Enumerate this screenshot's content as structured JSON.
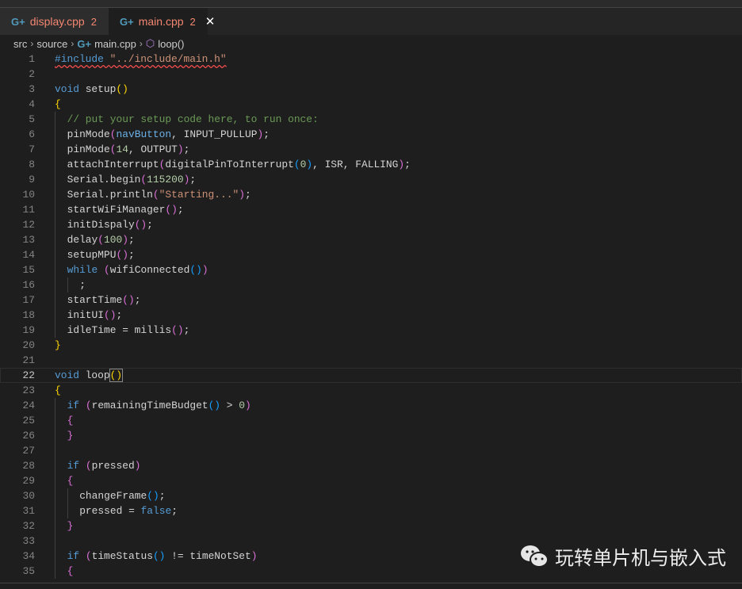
{
  "tabs": [
    {
      "label": "display.cpp",
      "problems": "2",
      "active": false
    },
    {
      "label": "main.cpp",
      "problems": "2",
      "active": true
    }
  ],
  "breadcrumb": [
    "src",
    "source",
    "main.cpp",
    "loop()"
  ],
  "current_line": 22,
  "lines": [
    {
      "n": "1",
      "i": 0,
      "t": [
        [
          "#include ",
          "inc"
        ],
        [
          "\"../include/main.h\"",
          "incs"
        ]
      ]
    },
    {
      "n": "2",
      "i": 0,
      "t": []
    },
    {
      "n": "3",
      "i": 0,
      "t": [
        [
          "void",
          "kw"
        ],
        [
          " setup",
          ""
        ],
        [
          "()",
          "b1"
        ]
      ]
    },
    {
      "n": "4",
      "i": 0,
      "t": [
        [
          "{",
          "b1"
        ]
      ]
    },
    {
      "n": "5",
      "i": 1,
      "t": [
        [
          "// put your setup code here, to run once:",
          "com"
        ]
      ]
    },
    {
      "n": "6",
      "i": 1,
      "t": [
        [
          "pinMode",
          ""
        ],
        [
          "(",
          "b2"
        ],
        [
          "navButton",
          "par"
        ],
        [
          ", INPUT_PULLUP",
          ""
        ],
        [
          ")",
          "b2"
        ],
        [
          ";",
          ""
        ]
      ]
    },
    {
      "n": "7",
      "i": 1,
      "t": [
        [
          "pinMode",
          ""
        ],
        [
          "(",
          "b2"
        ],
        [
          "14",
          "num"
        ],
        [
          ", OUTPUT",
          ""
        ],
        [
          ")",
          "b2"
        ],
        [
          ";",
          ""
        ]
      ]
    },
    {
      "n": "8",
      "i": 1,
      "t": [
        [
          "attachInterrupt",
          ""
        ],
        [
          "(",
          "b2"
        ],
        [
          "digitalPinToInterrupt",
          ""
        ],
        [
          "(",
          "b3"
        ],
        [
          "0",
          "num"
        ],
        [
          ")",
          "b3"
        ],
        [
          ", ISR, FALLING",
          ""
        ],
        [
          ")",
          "b2"
        ],
        [
          ";",
          ""
        ]
      ]
    },
    {
      "n": "9",
      "i": 1,
      "t": [
        [
          "Serial.begin",
          ""
        ],
        [
          "(",
          "b2"
        ],
        [
          "115200",
          "num"
        ],
        [
          ")",
          "b2"
        ],
        [
          ";",
          ""
        ]
      ]
    },
    {
      "n": "10",
      "i": 1,
      "t": [
        [
          "Serial.println",
          ""
        ],
        [
          "(",
          "b2"
        ],
        [
          "\"Starting...\"",
          "str"
        ],
        [
          ")",
          "b2"
        ],
        [
          ";",
          ""
        ]
      ]
    },
    {
      "n": "11",
      "i": 1,
      "t": [
        [
          "startWiFiManager",
          ""
        ],
        [
          "()",
          "b2"
        ],
        [
          ";",
          ""
        ]
      ]
    },
    {
      "n": "12",
      "i": 1,
      "t": [
        [
          "initDispaly",
          ""
        ],
        [
          "()",
          "b2"
        ],
        [
          ";",
          ""
        ]
      ]
    },
    {
      "n": "13",
      "i": 1,
      "t": [
        [
          "delay",
          ""
        ],
        [
          "(",
          "b2"
        ],
        [
          "100",
          "num"
        ],
        [
          ")",
          "b2"
        ],
        [
          ";",
          ""
        ]
      ]
    },
    {
      "n": "14",
      "i": 1,
      "t": [
        [
          "setupMPU",
          ""
        ],
        [
          "()",
          "b2"
        ],
        [
          ";",
          ""
        ]
      ]
    },
    {
      "n": "15",
      "i": 1,
      "t": [
        [
          "while",
          "kw"
        ],
        [
          " ",
          ""
        ],
        [
          "(",
          "b2"
        ],
        [
          "wifiConnected",
          ""
        ],
        [
          "()",
          "b3"
        ],
        [
          ")",
          "b2"
        ]
      ]
    },
    {
      "n": "16",
      "i": 2,
      "t": [
        [
          ";",
          ""
        ]
      ]
    },
    {
      "n": "17",
      "i": 1,
      "t": [
        [
          "startTime",
          ""
        ],
        [
          "()",
          "b2"
        ],
        [
          ";",
          ""
        ]
      ]
    },
    {
      "n": "18",
      "i": 1,
      "t": [
        [
          "initUI",
          ""
        ],
        [
          "()",
          "b2"
        ],
        [
          ";",
          ""
        ]
      ]
    },
    {
      "n": "19",
      "i": 1,
      "t": [
        [
          "idleTime = millis",
          ""
        ],
        [
          "()",
          "b2"
        ],
        [
          ";",
          ""
        ]
      ]
    },
    {
      "n": "20",
      "i": 0,
      "t": [
        [
          "}",
          "b1"
        ]
      ]
    },
    {
      "n": "21",
      "i": 0,
      "t": []
    },
    {
      "n": "22",
      "i": 0,
      "t": [
        [
          "void",
          "kw"
        ],
        [
          " loop",
          ""
        ],
        [
          "()",
          "bm"
        ]
      ]
    },
    {
      "n": "23",
      "i": 0,
      "t": [
        [
          "{",
          "b1"
        ]
      ]
    },
    {
      "n": "24",
      "i": 1,
      "t": [
        [
          "if",
          "kw"
        ],
        [
          " ",
          ""
        ],
        [
          "(",
          "b2"
        ],
        [
          "remainingTimeBudget",
          ""
        ],
        [
          "()",
          "b3"
        ],
        [
          " > ",
          ""
        ],
        [
          "0",
          "num"
        ],
        [
          ")",
          "b2"
        ]
      ]
    },
    {
      "n": "25",
      "i": 1,
      "t": [
        [
          "{",
          "b2"
        ]
      ]
    },
    {
      "n": "26",
      "i": 1,
      "t": [
        [
          "}",
          "b2"
        ]
      ]
    },
    {
      "n": "27",
      "i": 1,
      "t": []
    },
    {
      "n": "28",
      "i": 1,
      "t": [
        [
          "if",
          "kw"
        ],
        [
          " ",
          ""
        ],
        [
          "(",
          "b2"
        ],
        [
          "pressed",
          ""
        ],
        [
          ")",
          "b2"
        ]
      ]
    },
    {
      "n": "29",
      "i": 1,
      "t": [
        [
          "{",
          "b2"
        ]
      ]
    },
    {
      "n": "30",
      "i": 2,
      "t": [
        [
          "changeFrame",
          ""
        ],
        [
          "()",
          "b3"
        ],
        [
          ";",
          ""
        ]
      ]
    },
    {
      "n": "31",
      "i": 2,
      "t": [
        [
          "pressed = ",
          ""
        ],
        [
          "false",
          "kw"
        ],
        [
          ";",
          ""
        ]
      ]
    },
    {
      "n": "32",
      "i": 1,
      "t": [
        [
          "}",
          "b2"
        ]
      ]
    },
    {
      "n": "33",
      "i": 1,
      "t": []
    },
    {
      "n": "34",
      "i": 1,
      "t": [
        [
          "if",
          "kw"
        ],
        [
          " ",
          ""
        ],
        [
          "(",
          "b2"
        ],
        [
          "timeStatus",
          ""
        ],
        [
          "()",
          "b3"
        ],
        [
          " != timeNotSet",
          ""
        ],
        [
          ")",
          "b2"
        ]
      ]
    },
    {
      "n": "35",
      "i": 1,
      "t": [
        [
          "{",
          "b2"
        ]
      ]
    }
  ],
  "watermark": {
    "text": "玩转单片机与嵌入式",
    "icon": "wechat-icon"
  },
  "colors": {
    "keyword": "#569cd6",
    "string": "#ce9178",
    "number": "#b5cea8",
    "comment": "#6a9955",
    "error": "#f48771"
  }
}
